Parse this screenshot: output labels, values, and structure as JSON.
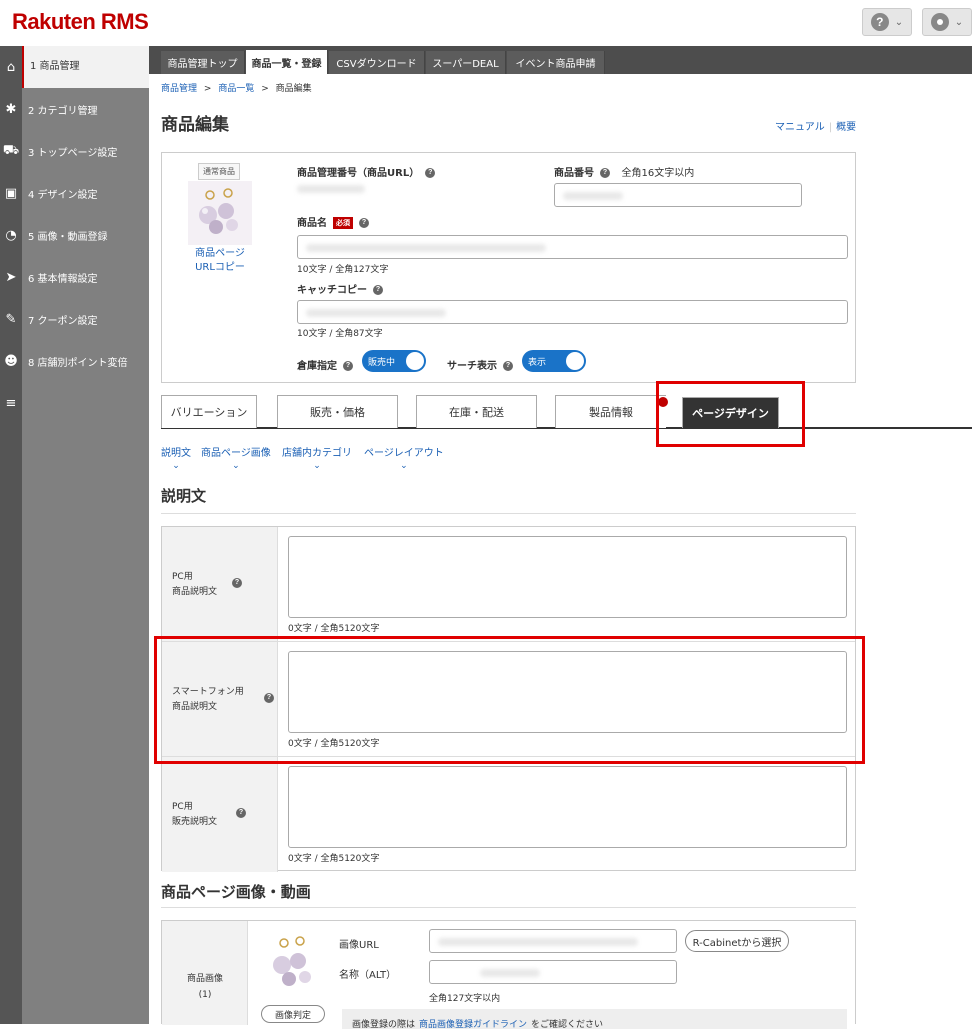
{
  "header": {
    "logo_rakuten": "Rakuten",
    "logo_rms": " RMS",
    "help_icon_char": "?",
    "user_icon_char": "●",
    "chevron_char": "⌄"
  },
  "sidebar": {
    "items": [
      {
        "icon": "home-icon",
        "glyph": "⌂",
        "label": "1  商品管理"
      },
      {
        "icon": "gear-icon",
        "glyph": "✱",
        "label": "2  カテゴリ管理"
      },
      {
        "icon": "cart-icon",
        "glyph": "⛟",
        "label": "3  トップページ設定"
      },
      {
        "icon": "design-icon",
        "glyph": "▣",
        "label": "4  デザイン設定"
      },
      {
        "icon": "media-icon",
        "glyph": "◔",
        "label": "5  画像・動画登録"
      },
      {
        "icon": "send-icon",
        "glyph": "➤",
        "label": "6  基本情報設定"
      },
      {
        "icon": "coupon-icon",
        "glyph": "✎",
        "label": "7  クーポン設定"
      },
      {
        "icon": "users-icon",
        "glyph": "☻",
        "label": "8  店舗別ポイント変倍"
      },
      {
        "icon": "list-icon",
        "glyph": "≡",
        "label": ""
      }
    ]
  },
  "top_tabs": [
    {
      "label": "商品管理トップ"
    },
    {
      "label": "商品一覧・登録"
    },
    {
      "label": "CSVダウンロード"
    },
    {
      "label": "スーパーDEAL"
    },
    {
      "label": "イベント商品申請"
    }
  ],
  "breadcrumb": {
    "b1": "商品管理",
    "b2": "商品一覧",
    "b3": "商品編集",
    "sep": ">"
  },
  "page": {
    "title": "商品編集",
    "manual_link": "マニュアル",
    "overview_link": "概要",
    "link_sep": "|"
  },
  "product": {
    "badge": "通常商品",
    "url_copy_line1": "商品ページ",
    "url_copy_line2": "URLコピー",
    "manage_no_label": "商品管理番号（商品URL）",
    "item_no_label": "商品番号",
    "item_no_hint": "全角16文字以内",
    "name_label": "商品名",
    "required_badge": "必須",
    "name_count": "10文字 / 全角127文字",
    "catch_label": "キャッチコピー",
    "catch_count": "10文字 / 全角87文字",
    "warehouse_label": "倉庫指定",
    "warehouse_toggle": "販売中",
    "search_label": "サーチ表示",
    "search_toggle": "表示",
    "help": "?"
  },
  "section_tabs": [
    {
      "label": "バリエーション"
    },
    {
      "label": "販売・価格"
    },
    {
      "label": "在庫・配送"
    },
    {
      "label": "製品情報"
    },
    {
      "label": "ページデザイン"
    }
  ],
  "anchors": [
    {
      "label": "説明文"
    },
    {
      "label": "商品ページ画像"
    },
    {
      "label": "店舗内カテゴリ"
    },
    {
      "label": "ページレイアウト"
    }
  ],
  "anchor_chevron": "⌄",
  "description": {
    "heading": "説明文",
    "rows": [
      {
        "line1": "PC用",
        "line2": "商品説明文",
        "count": "0文字 / 全角5120文字"
      },
      {
        "line1": "スマートフォン用",
        "line2": "商品説明文",
        "count": "0文字 / 全角5120文字"
      },
      {
        "line1": "PC用",
        "line2": "販売説明文",
        "count": "0文字 / 全角5120文字"
      }
    ]
  },
  "images": {
    "heading": "商品ページ画像・動画",
    "label_line1": "商品画像",
    "label_line2": "(1)",
    "judge_button": "画像判定",
    "url_label": "画像URL",
    "alt_label": "名称（ALT）",
    "alt_hint": "全角127文字以内",
    "cabinet_button": "R-Cabinetから選択",
    "note_start": "画像登録の際は",
    "note_link": "商品画像登録ガイドライン",
    "note_end": "をご確認ください"
  },
  "colors": {
    "brand_red": "#bf0000",
    "highlight_red": "#e00000",
    "link_blue": "#1a5fb4",
    "toggle_blue": "#1a73c8",
    "sidebar_gray": "#808080"
  }
}
